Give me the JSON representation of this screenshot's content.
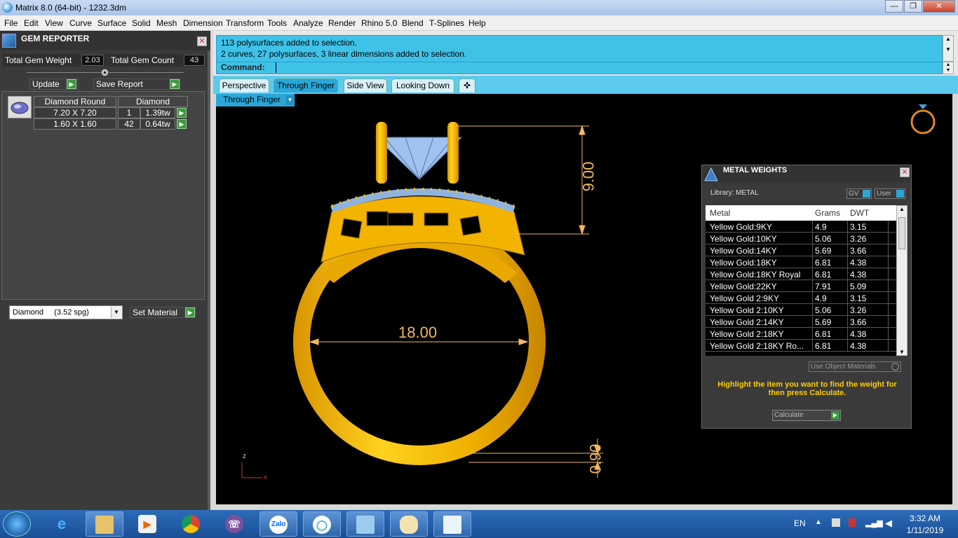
{
  "titlebar": {
    "title": "Matrix 8.0 (64-bit) - 1232.3dm"
  },
  "menu": [
    "File",
    "Edit",
    "View",
    "Curve",
    "Surface",
    "Solid",
    "Mesh",
    "Dimension",
    "Transform",
    "Tools",
    "Analyze",
    "Render",
    "Rhino 5.0",
    "Blend",
    "T-Splines",
    "Help"
  ],
  "gem_reporter": {
    "title": "GEM REPORTER",
    "total_weight_label": "Total Gem Weight",
    "total_weight": "2.03",
    "total_count_label": "Total Gem Count",
    "total_count": "43",
    "update_label": "Update",
    "save_label": "Save Report",
    "col_shape": "Diamond Round",
    "col_material": "Diamond",
    "rows": [
      {
        "size": "7.20 X 7.20",
        "count": "1",
        "weight": "1.39tw"
      },
      {
        "size": "1.60 X 1.60",
        "count": "42",
        "weight": "0.64tw"
      }
    ],
    "material_select": "Diamond     (3.52 spg)",
    "set_material_label": "Set Material"
  },
  "command": {
    "line1": "113 polysurfaces added to selection.",
    "line2": "2 curves, 27 polysurfaces, 3 linear dimensions added to selection.",
    "prompt": "Command:"
  },
  "tabs": [
    "Perspective",
    "Through Finger",
    "Side View",
    "Looking Down"
  ],
  "viewport": {
    "name": "Through Finger",
    "dim_height": "9.00",
    "dim_width": "18.00",
    "dim_thickness": "0.90",
    "axis_z": "z",
    "axis_x": "x"
  },
  "metal_weights": {
    "title": "METAL WEIGHTS",
    "library": "Library: METAL",
    "gv_label": "GV",
    "user_label": "User",
    "col_metal": "Metal",
    "col_grams": "Grams",
    "col_dwt": "DWT",
    "rows": [
      {
        "metal": "Yellow Gold:9KY",
        "grams": "4.9",
        "dwt": "3.15"
      },
      {
        "metal": "Yellow Gold:10KY",
        "grams": "5.06",
        "dwt": "3.26"
      },
      {
        "metal": "Yellow Gold:14KY",
        "grams": "5.69",
        "dwt": "3.66"
      },
      {
        "metal": "Yellow Gold:18KY",
        "grams": "6.81",
        "dwt": "4.38"
      },
      {
        "metal": "Yellow Gold:18KY Royal",
        "grams": "6.81",
        "dwt": "4.38"
      },
      {
        "metal": "Yellow Gold:22KY",
        "grams": "7.91",
        "dwt": "5.09"
      },
      {
        "metal": "Yellow Gold 2:9KY",
        "grams": "4.9",
        "dwt": "3.15"
      },
      {
        "metal": "Yellow Gold 2:10KY",
        "grams": "5.06",
        "dwt": "3.26"
      },
      {
        "metal": "Yellow Gold 2:14KY",
        "grams": "5.69",
        "dwt": "3.66"
      },
      {
        "metal": "Yellow Gold 2:18KY",
        "grams": "6.81",
        "dwt": "4.38"
      },
      {
        "metal": "Yellow Gold 2:18KY Ro...",
        "grams": "6.81",
        "dwt": "4.38"
      }
    ],
    "use_object_label": "Use Object Materials",
    "hint": "Highlight the item you want to find the weight for then press Calculate.",
    "calculate_label": "Calculate"
  },
  "taskbar": {
    "lang": "EN",
    "time": "3:32 AM",
    "date": "1/11/2019",
    "zalo_label": "Zalo"
  },
  "colors": {
    "accent": "#3fc2e8",
    "gold": "#f2b400",
    "hint": "#ffcc00"
  }
}
